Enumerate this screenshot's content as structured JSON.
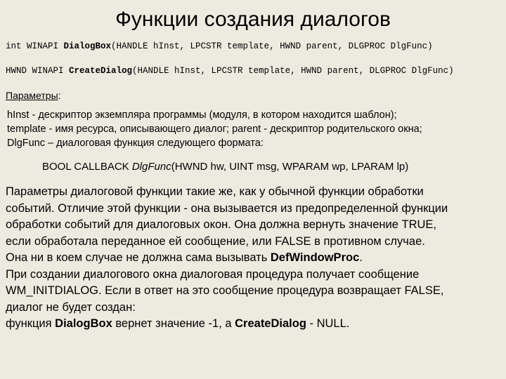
{
  "slide": {
    "background_color": "#edebe0",
    "text_color": "#000000",
    "title": "Функции создания диалогов",
    "signatures": [
      {
        "prefix": "int WINAPI ",
        "fn": "DialogBox",
        "suffix": "(HANDLE hInst, LPCSTR template, HWND parent, DLGPROC DlgFunc)"
      },
      {
        "prefix": "HWND WINAPI ",
        "fn": "CreateDialog",
        "suffix": "(HANDLE hInst, LPCSTR template, HWND parent, DLGPROC DlgFunc)"
      }
    ],
    "params_heading": {
      "underlined": "Параметры",
      "colon": ":"
    },
    "param_lines": [
      "hInst - дескриптор экземпляра программы (модуля, в котором находится шаблон);",
      "template - имя ресурса, описывающего диалог; parent - дескриптор родительского окна;",
      "DlgFunc – диалоговая  функция следующего формата:"
    ],
    "callback": {
      "prefix": "BOOL CALLBACK ",
      "italic": "DlgFunc",
      "suffix": "(HWND hw, UINT msg, WPARAM wp, LPARAM lp)"
    },
    "body_lines": [
      {
        "text": "Параметры диалоговой функции такие же, как у обычной функции обработки"
      },
      {
        "text": "событий. Отличие этой функции - она вызывается из предопределенной функции"
      },
      {
        "text": "обработки событий для диалоговых окон. Она должна вернуть значение TRUE,"
      },
      {
        "text": "если обработала переданное ей сообщение, или FALSE в противном случае."
      },
      {
        "pre": "Она ни в коем случае не должна сама вызывать ",
        "bold": "DefWindowProc",
        "post": "."
      },
      {
        "text": "При создании диалогового окна диалоговая процедура получает сообщение"
      },
      {
        "text": "WM_INITDIALOG. Если в ответ на это сообщение процедура возвращает FALSE,"
      },
      {
        "text": "диалог не будет создан:"
      },
      {
        "pre": " функция ",
        "bold": "DialogBox",
        "mid": " вернет значение -1, а ",
        "bold2": "CreateDialog",
        "post": " - NULL."
      }
    ]
  }
}
